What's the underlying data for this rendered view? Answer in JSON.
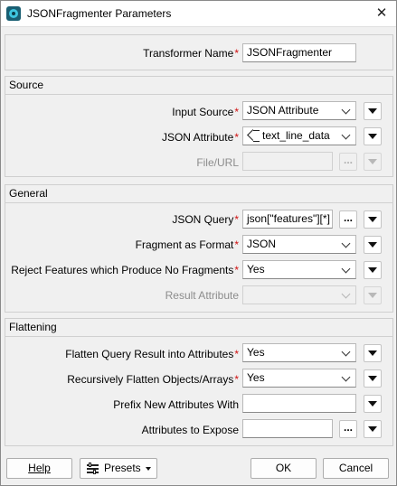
{
  "window": {
    "title": "JSONFragmenter Parameters",
    "close_glyph": "✕",
    "icon": "app-icon"
  },
  "transformer": {
    "label": "Transformer Name",
    "value": "JSONFragmenter",
    "required": "*"
  },
  "source": {
    "title": "Source",
    "input_source": {
      "label": "Input Source",
      "value": "JSON Attribute",
      "required": "*"
    },
    "json_attribute": {
      "label": "JSON Attribute",
      "value": "text_line_data",
      "required": "*",
      "icon": "attribute-icon"
    },
    "file_url": {
      "label": "File/URL",
      "value": "",
      "ellipsis": "..."
    }
  },
  "general": {
    "title": "General",
    "json_query": {
      "label": "JSON Query",
      "value": "json[\"features\"][*]",
      "required": "*",
      "ellipsis": "..."
    },
    "fragment_format": {
      "label": "Fragment as Format",
      "value": "JSON",
      "required": "*"
    },
    "reject_features": {
      "label": "Reject Features which Produce No Fragments",
      "value": "Yes",
      "required": "*"
    },
    "result_attribute": {
      "label": "Result Attribute",
      "value": ""
    }
  },
  "flattening": {
    "title": "Flattening",
    "flatten_query": {
      "label": "Flatten Query Result into Attributes",
      "value": "Yes",
      "required": "*"
    },
    "recursive_flatten": {
      "label": "Recursively Flatten Objects/Arrays",
      "value": "Yes",
      "required": "*"
    },
    "prefix": {
      "label": "Prefix New Attributes With",
      "value": ""
    },
    "expose": {
      "label": "Attributes to Expose",
      "value": "",
      "ellipsis": "..."
    }
  },
  "footer": {
    "help": "Help",
    "presets": "Presets",
    "ok": "OK",
    "cancel": "Cancel"
  }
}
